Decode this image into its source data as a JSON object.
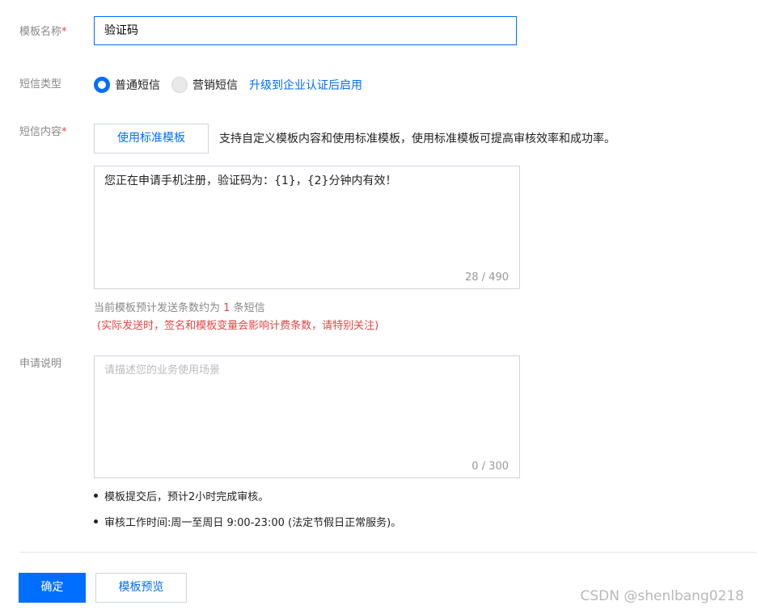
{
  "template_name": {
    "label": "模板名称",
    "required_mark": "*",
    "value": "验证码"
  },
  "sms_type": {
    "label": "短信类型",
    "options": [
      {
        "label": "普通短信",
        "selected": true
      },
      {
        "label": "营销短信",
        "selected": false
      }
    ],
    "upgrade_link": "升级到企业认证后启用"
  },
  "sms_content": {
    "label": "短信内容",
    "required_mark": "*",
    "standard_template_button": "使用标准模板",
    "hint": "支持自定义模板内容和使用标准模板，使用标准模板可提高审核效率和成功率。",
    "value": "您正在申请手机注册，验证码为：{1}，{2}分钟内有效！",
    "counter": "28 / 490",
    "count_prefix": "当前模板预计发送条数约为",
    "count_value": "1",
    "count_suffix": "条短信",
    "warning": "(实际发送时，签名和模板变量会影响计费条数，请特别关注)"
  },
  "application_note": {
    "label": "申请说明",
    "placeholder": "请描述您的业务使用场景",
    "counter": "0 / 300"
  },
  "notes": [
    "模板提交后，预计2小时完成审核。",
    "审核工作时间:周一至周日 9:00-23:00 (法定节假日正常服务)。"
  ],
  "actions": {
    "confirm": "确定",
    "preview": "模板预览"
  },
  "watermark": "CSDN @shenlbang0218",
  "colors": {
    "primary": "#006eff",
    "required": "#e54545",
    "label": "#888888"
  }
}
